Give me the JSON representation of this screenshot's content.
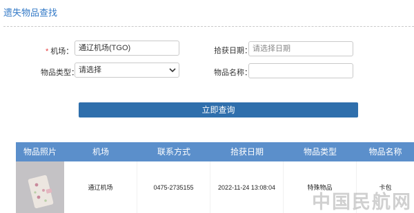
{
  "page": {
    "title": "遗失物品查找"
  },
  "form": {
    "airport": {
      "required_mark": "*",
      "label": "机场：",
      "value": "通辽机场(TGO)"
    },
    "found_date": {
      "label": "拾获日期：",
      "placeholder": "请选择日期"
    },
    "item_type": {
      "label": "物品类型：",
      "selected": "请选择"
    },
    "item_name": {
      "label": "物品名称：",
      "value": ""
    }
  },
  "submit_label": "立即查询",
  "table": {
    "headers": [
      "物品照片",
      "机场",
      "联系方式",
      "拾获日期",
      "物品类型",
      "物品名称"
    ],
    "rows": [
      {
        "airport": "通辽机场",
        "contact": "0475-2735155",
        "date": "2022-11-24 13:08:04",
        "type": "特殊物品",
        "name": "卡包"
      }
    ]
  },
  "watermark": "中国民航网",
  "colors": {
    "accent": "#3178c6",
    "header_bg": "#5b8fcb",
    "button_bg": "#2f6fac",
    "required": "#e4393c"
  }
}
